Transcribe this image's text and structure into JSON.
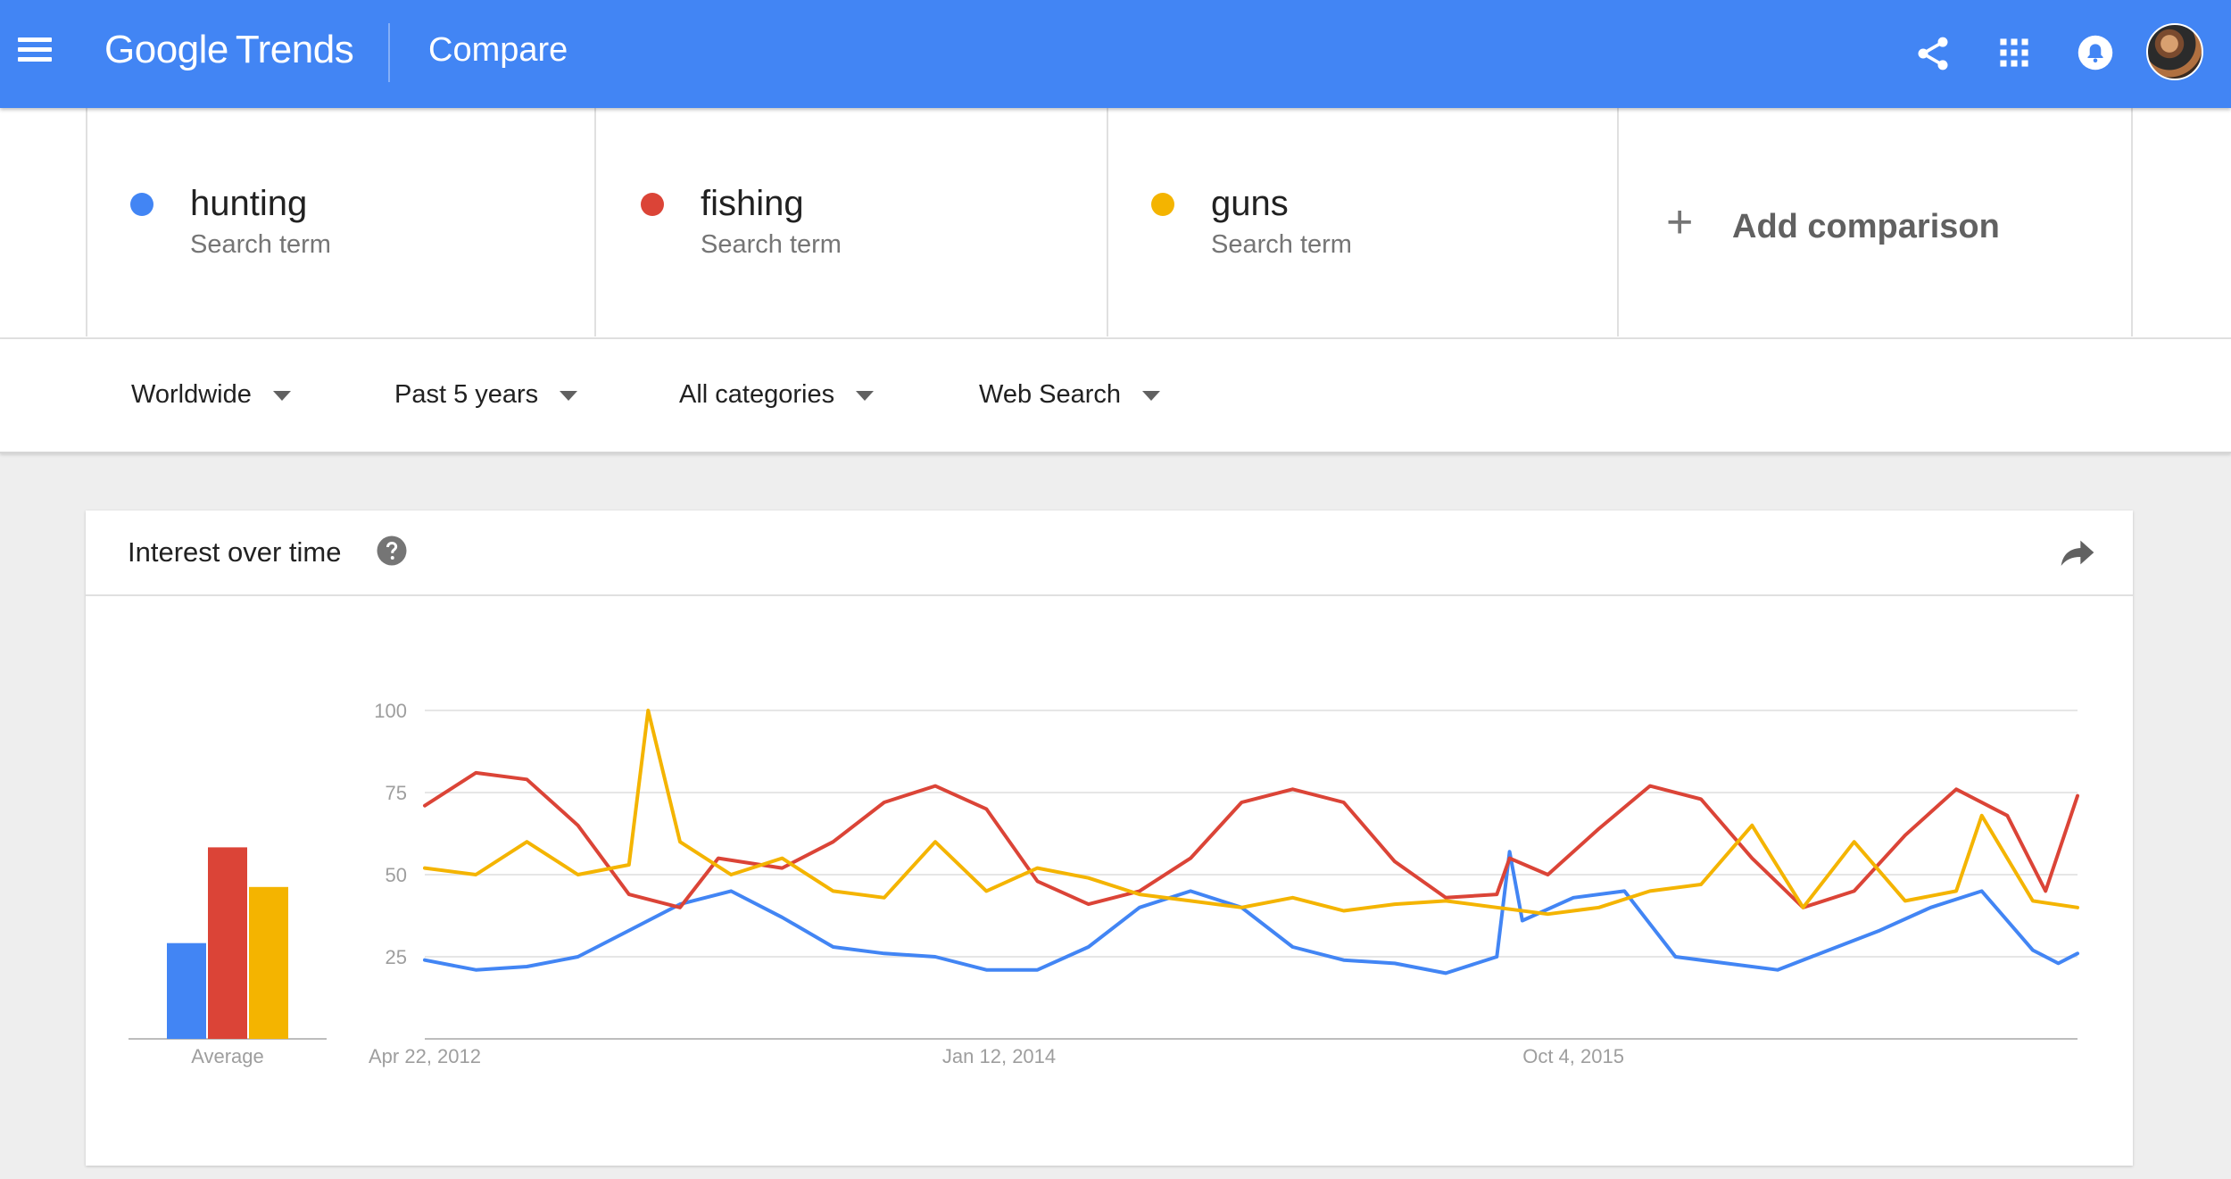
{
  "header": {
    "logo_google": "Google",
    "logo_trends": "Trends",
    "title": "Compare",
    "icons": [
      "menu-icon",
      "share-icon",
      "apps-icon",
      "notifications-icon",
      "avatar"
    ]
  },
  "terms": [
    {
      "name": "hunting",
      "type": "Search term",
      "color": "#4285f4"
    },
    {
      "name": "fishing",
      "type": "Search term",
      "color": "#db4437"
    },
    {
      "name": "guns",
      "type": "Search term",
      "color": "#f4b400"
    }
  ],
  "add_comparison": {
    "icon": "+",
    "label": "Add comparison"
  },
  "filters": {
    "region": "Worldwide",
    "time": "Past 5 years",
    "category": "All categories",
    "property": "Web Search"
  },
  "card": {
    "title": "Interest over time",
    "help_icon": "help-icon",
    "share_icon": "share-arrow-icon"
  },
  "chart_data": [
    {
      "type": "bar",
      "categories": [
        "hunting",
        "fishing",
        "guns"
      ],
      "values": [
        29,
        58,
        46
      ],
      "colors": [
        "#4285f4",
        "#db4437",
        "#f4b400"
      ],
      "xlabel": "Average",
      "ylim": [
        0,
        100
      ]
    },
    {
      "type": "line",
      "ylim": [
        0,
        100
      ],
      "y_ticks": [
        25,
        50,
        75,
        100
      ],
      "x_range": [
        "2012-04-22",
        "2017-04-09"
      ],
      "x_tick_labels": [
        {
          "date": "2012-04-22",
          "label": "Apr 22, 2012"
        },
        {
          "date": "2014-01-12",
          "label": "Jan 12, 2014"
        },
        {
          "date": "2015-10-04",
          "label": "Oct 4, 2015"
        }
      ],
      "grid": true,
      "series": [
        {
          "name": "hunting",
          "color": "#4285f4",
          "points": [
            [
              "2012-04-22",
              24
            ],
            [
              "2012-06-17",
              21
            ],
            [
              "2012-08-12",
              22
            ],
            [
              "2012-10-07",
              25
            ],
            [
              "2012-12-02",
              33
            ],
            [
              "2013-01-27",
              41
            ],
            [
              "2013-03-24",
              45
            ],
            [
              "2013-05-19",
              37
            ],
            [
              "2013-07-14",
              28
            ],
            [
              "2013-09-08",
              26
            ],
            [
              "2013-11-03",
              25
            ],
            [
              "2013-12-29",
              21
            ],
            [
              "2014-02-23",
              21
            ],
            [
              "2014-04-20",
              28
            ],
            [
              "2014-06-15",
              40
            ],
            [
              "2014-08-10",
              45
            ],
            [
              "2014-10-05",
              40
            ],
            [
              "2014-11-30",
              28
            ],
            [
              "2015-01-25",
              24
            ],
            [
              "2015-03-22",
              23
            ],
            [
              "2015-05-17",
              20
            ],
            [
              "2015-07-12",
              25
            ],
            [
              "2015-07-26",
              57
            ],
            [
              "2015-08-09",
              36
            ],
            [
              "2015-10-04",
              43
            ],
            [
              "2015-11-29",
              45
            ],
            [
              "2016-01-24",
              25
            ],
            [
              "2016-03-20",
              23
            ],
            [
              "2016-05-15",
              21
            ],
            [
              "2016-07-10",
              27
            ],
            [
              "2016-09-04",
              33
            ],
            [
              "2016-10-30",
              40
            ],
            [
              "2016-12-25",
              45
            ],
            [
              "2017-02-19",
              27
            ],
            [
              "2017-03-19",
              23
            ],
            [
              "2017-04-09",
              26
            ]
          ]
        },
        {
          "name": "fishing",
          "color": "#db4437",
          "points": [
            [
              "2012-04-22",
              71
            ],
            [
              "2012-06-17",
              81
            ],
            [
              "2012-08-12",
              79
            ],
            [
              "2012-10-07",
              65
            ],
            [
              "2012-12-02",
              44
            ],
            [
              "2013-01-27",
              40
            ],
            [
              "2013-03-10",
              55
            ],
            [
              "2013-05-19",
              52
            ],
            [
              "2013-07-14",
              60
            ],
            [
              "2013-09-08",
              72
            ],
            [
              "2013-11-03",
              77
            ],
            [
              "2013-12-29",
              70
            ],
            [
              "2014-02-23",
              48
            ],
            [
              "2014-04-20",
              41
            ],
            [
              "2014-06-15",
              45
            ],
            [
              "2014-08-10",
              55
            ],
            [
              "2014-10-05",
              72
            ],
            [
              "2014-11-30",
              76
            ],
            [
              "2015-01-25",
              72
            ],
            [
              "2015-03-22",
              54
            ],
            [
              "2015-05-17",
              43
            ],
            [
              "2015-07-12",
              44
            ],
            [
              "2015-07-26",
              55
            ],
            [
              "2015-09-06",
              50
            ],
            [
              "2015-11-01",
              64
            ],
            [
              "2015-12-27",
              77
            ],
            [
              "2016-02-21",
              73
            ],
            [
              "2016-04-17",
              55
            ],
            [
              "2016-06-12",
              40
            ],
            [
              "2016-08-07",
              45
            ],
            [
              "2016-10-02",
              62
            ],
            [
              "2016-11-27",
              76
            ],
            [
              "2017-01-22",
              68
            ],
            [
              "2017-03-05",
              45
            ],
            [
              "2017-04-09",
              74
            ]
          ]
        },
        {
          "name": "guns",
          "color": "#f4b400",
          "points": [
            [
              "2012-04-22",
              52
            ],
            [
              "2012-06-17",
              50
            ],
            [
              "2012-08-12",
              60
            ],
            [
              "2012-10-07",
              50
            ],
            [
              "2012-12-02",
              53
            ],
            [
              "2012-12-23",
              100
            ],
            [
              "2013-01-27",
              60
            ],
            [
              "2013-03-24",
              50
            ],
            [
              "2013-05-19",
              55
            ],
            [
              "2013-07-14",
              45
            ],
            [
              "2013-09-08",
              43
            ],
            [
              "2013-11-03",
              60
            ],
            [
              "2013-12-29",
              45
            ],
            [
              "2014-02-23",
              52
            ],
            [
              "2014-04-20",
              49
            ],
            [
              "2014-06-15",
              44
            ],
            [
              "2014-08-10",
              42
            ],
            [
              "2014-10-05",
              40
            ],
            [
              "2014-11-30",
              43
            ],
            [
              "2015-01-25",
              39
            ],
            [
              "2015-03-22",
              41
            ],
            [
              "2015-05-17",
              42
            ],
            [
              "2015-07-12",
              40
            ],
            [
              "2015-09-06",
              38
            ],
            [
              "2015-11-01",
              40
            ],
            [
              "2015-12-27",
              45
            ],
            [
              "2016-02-21",
              47
            ],
            [
              "2016-04-17",
              65
            ],
            [
              "2016-06-12",
              40
            ],
            [
              "2016-08-07",
              60
            ],
            [
              "2016-10-02",
              42
            ],
            [
              "2016-11-27",
              45
            ],
            [
              "2016-12-25",
              68
            ],
            [
              "2017-02-19",
              42
            ],
            [
              "2017-04-09",
              40
            ]
          ]
        }
      ]
    }
  ]
}
